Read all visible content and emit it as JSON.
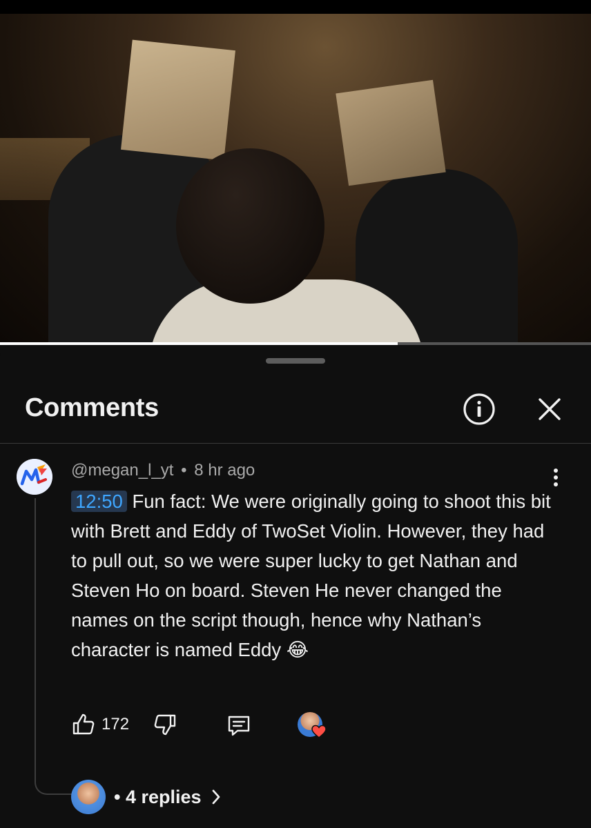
{
  "video": {
    "progress_fraction": 0.673
  },
  "comments_panel": {
    "title": "Comments",
    "info_icon": "info-icon",
    "close_icon": "close-icon"
  },
  "comment": {
    "author": "@megan_l_yt",
    "separator": "•",
    "age": "8 hr ago",
    "timestamp_link": "12:50",
    "text": " Fun fact: We were originally going to shoot this bit with Brett and Eddy of TwoSet Violin. However, they had to pull out, so we were super lucky to get Nathan and Steven Ho on board. Steven He never changed the names on the script though, hence why Nathan’s character is named Eddy 😂",
    "likes": "172",
    "replies_label": "• 4 replies",
    "icons": {
      "like": "thumbs-up-icon",
      "dislike": "thumbs-down-icon",
      "reply": "reply-icon",
      "more": "more-vertical-icon",
      "creator_heart": "heart-icon",
      "chevron": "chevron-right-icon"
    },
    "colors": {
      "timestamp_bg": "#263850",
      "timestamp_fg": "#3ea6ff",
      "heart": "#ff4e45"
    }
  }
}
